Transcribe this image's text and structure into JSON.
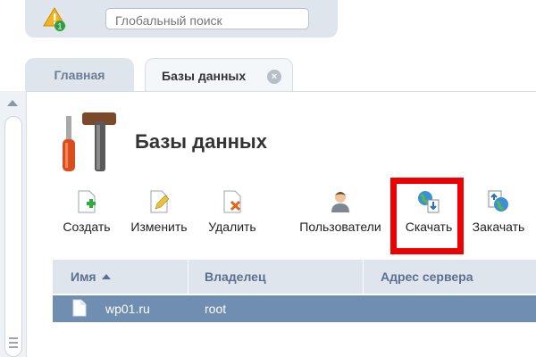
{
  "header": {
    "search_placeholder": "Глобальный поиск",
    "warning_badge": "1"
  },
  "tabs": [
    {
      "label": "Главная",
      "active": false
    },
    {
      "label": "Базы данных",
      "active": true
    }
  ],
  "page": {
    "title": "Базы данных"
  },
  "toolbar": {
    "items": [
      {
        "label": "Создать",
        "icon": "create-icon"
      },
      {
        "label": "Изменить",
        "icon": "edit-icon"
      },
      {
        "label": "Удалить",
        "icon": "delete-icon"
      },
      {
        "label": "Пользователи",
        "icon": "users-icon"
      },
      {
        "label": "Скачать",
        "icon": "download-icon",
        "highlighted": true
      },
      {
        "label": "Закачать",
        "icon": "upload-icon"
      }
    ]
  },
  "table": {
    "columns": [
      {
        "label": "Имя",
        "sort": "asc"
      },
      {
        "label": "Владелец"
      },
      {
        "label": "Адрес сервера"
      }
    ],
    "rows": [
      {
        "name": "wp01.ru",
        "owner": "root",
        "server": "",
        "selected": true
      }
    ]
  },
  "colors": {
    "accent": "#ee0000",
    "selected_row": "#6f8eb1",
    "header_bg": "#dfe5ec"
  }
}
